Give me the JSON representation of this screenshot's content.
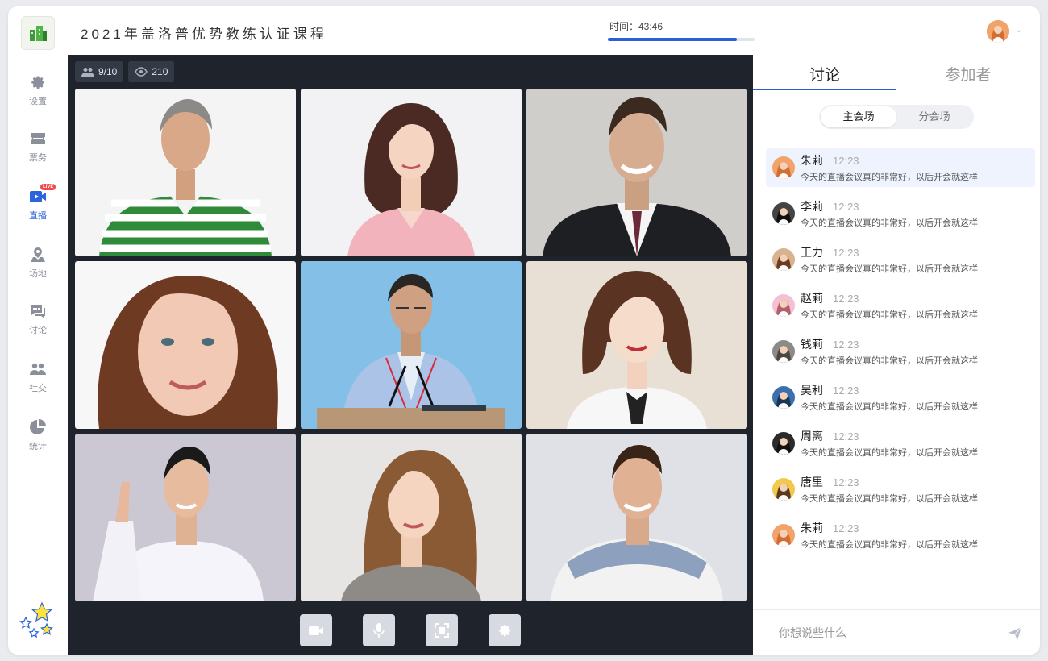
{
  "header": {
    "course_title": "2021年盖洛普优势教练认证课程",
    "timer_label": "时间：43:46",
    "timer_progress": 0.88
  },
  "sidebar": {
    "items": [
      {
        "label": "设置",
        "icon": "gear-icon"
      },
      {
        "label": "票务",
        "icon": "ticket-icon"
      },
      {
        "label": "直播",
        "icon": "live-video-icon",
        "active": true,
        "badge": "LIVE"
      },
      {
        "label": "场地",
        "icon": "location-icon"
      },
      {
        "label": "讨论",
        "icon": "chat-icon"
      },
      {
        "label": "社交",
        "icon": "people-icon"
      },
      {
        "label": "统计",
        "icon": "pie-chart-icon"
      }
    ]
  },
  "stage": {
    "participants_count": "9/10",
    "viewers_count": "210"
  },
  "panel": {
    "tabs": [
      "讨论",
      "参加者"
    ],
    "active_tab": 0,
    "segments": [
      "主会场",
      "分会场"
    ],
    "active_segment": 0,
    "messages": [
      {
        "name": "朱莉",
        "time": "12:23",
        "text": "今天的直播会议真的非常好，以后开会就这样",
        "highlight": true
      },
      {
        "name": "李莉",
        "time": "12:23",
        "text": "今天的直播会议真的非常好，以后开会就这样"
      },
      {
        "name": "王力",
        "time": "12:23",
        "text": "今天的直播会议真的非常好，以后开会就这样"
      },
      {
        "name": "赵莉",
        "time": "12:23",
        "text": "今天的直播会议真的非常好，以后开会就这样"
      },
      {
        "name": "钱莉",
        "time": "12:23",
        "text": "今天的直播会议真的非常好，以后开会就这样"
      },
      {
        "name": "吴利",
        "time": "12:23",
        "text": "今天的直播会议真的非常好，以后开会就这样"
      },
      {
        "name": "周离",
        "time": "12:23",
        "text": "今天的直播会议真的非常好，以后开会就这样"
      },
      {
        "name": "唐里",
        "time": "12:23",
        "text": "今天的直播会议真的非常好，以后开会就这样"
      },
      {
        "name": "朱莉",
        "time": "12:23",
        "text": "今天的直播会议真的非常好，以后开会就这样"
      }
    ],
    "composer_placeholder": "你想说些什么"
  },
  "colors": {
    "accent": "#2b5fd3",
    "stage_bg": "#1f232b",
    "live_badge": "#f04848"
  }
}
